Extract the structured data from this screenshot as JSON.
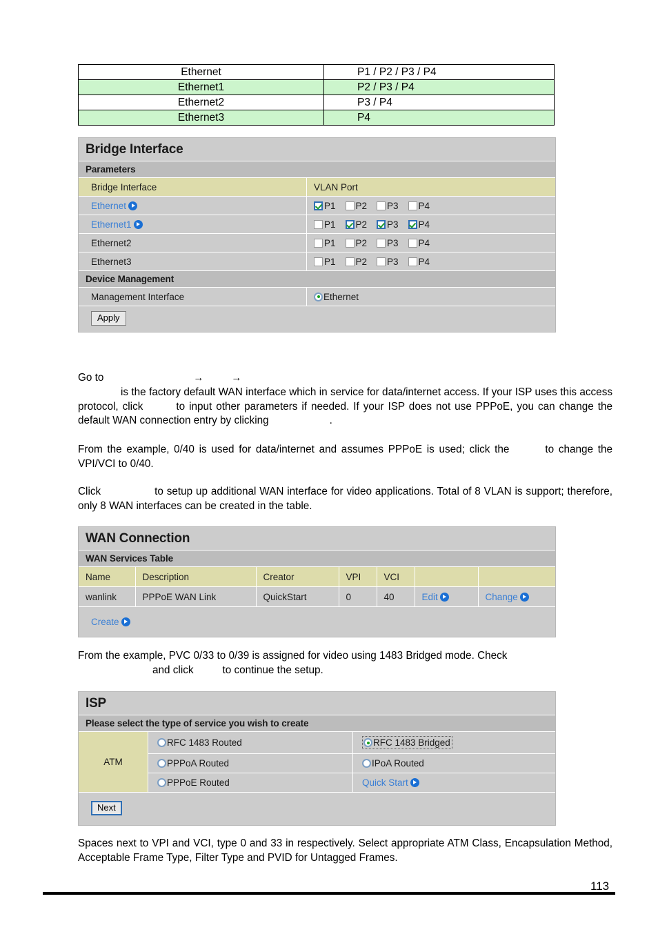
{
  "vlan_table": {
    "rows": [
      {
        "interface": "Ethernet",
        "ports": "P1 / P2 / P3 / P4"
      },
      {
        "interface": "Ethernet1",
        "ports": "P2 / P3 / P4"
      },
      {
        "interface": "Ethernet2",
        "ports": "P3 / P4"
      },
      {
        "interface": "Ethernet3",
        "ports": "P4"
      }
    ]
  },
  "bridge_panel": {
    "title": "Bridge Interface",
    "subhead": "Parameters",
    "header": {
      "left": "Bridge Interface",
      "right": "VLAN Port"
    },
    "rows": [
      {
        "name": "Ethernet",
        "is_link": true,
        "ports": [
          {
            "label": "P1",
            "checked": true
          },
          {
            "label": "P2",
            "checked": false
          },
          {
            "label": "P3",
            "checked": false
          },
          {
            "label": "P4",
            "checked": false
          }
        ]
      },
      {
        "name": "Ethernet1",
        "is_link": true,
        "ports": [
          {
            "label": "P1",
            "checked": false
          },
          {
            "label": "P2",
            "checked": true
          },
          {
            "label": "P3",
            "checked": true
          },
          {
            "label": "P4",
            "checked": true
          }
        ]
      },
      {
        "name": "Ethernet2",
        "is_link": false,
        "ports": [
          {
            "label": "P1",
            "checked": false
          },
          {
            "label": "P2",
            "checked": false
          },
          {
            "label": "P3",
            "checked": false
          },
          {
            "label": "P4",
            "checked": false
          }
        ]
      },
      {
        "name": "Ethernet3",
        "is_link": false,
        "ports": [
          {
            "label": "P1",
            "checked": false
          },
          {
            "label": "P2",
            "checked": false
          },
          {
            "label": "P3",
            "checked": false
          },
          {
            "label": "P4",
            "checked": false
          }
        ]
      }
    ],
    "device_management": {
      "subhead": "Device Management",
      "label": "Management Interface",
      "option": "Ethernet",
      "selected": true
    },
    "apply_label": "Apply"
  },
  "paragraphs": {
    "p1_a": "Go to",
    "p1_arrow1": "→",
    "p1_arrow2": "→",
    "p2_a": "is the factory default WAN interface which in service for data/internet access. If your ISP uses this access protocol, click",
    "p2_b": "to input other parameters if needed.  If your ISP does not use PPPoE, you can change the default WAN connection entry by clicking",
    "p2_c": ".",
    "p3_a": "From the example, 0/40 is used for data/internet and assumes PPPoE is used; click the",
    "p3_b": "to change the VPI/VCI to 0/40.",
    "p4_a": "Click",
    "p4_b": "to setup up additional WAN interface for video applications. Total of 8 VLAN is support; therefore, only 8 WAN interfaces can be created in the table.",
    "p5_a": "From the example, PVC 0/33 to 0/39 is assigned for video using 1483 Bridged mode.  Check",
    "p5_b": "and click",
    "p5_c": "to continue the setup.",
    "p6": "Spaces next to VPI and VCI, type 0 and 33 in respectively. Select appropriate ATM Class, Encapsulation Method, Acceptable Frame Type, Filter Type and PVID for Untagged Frames."
  },
  "wan_panel": {
    "title": "WAN Connection",
    "subhead": "WAN Services Table",
    "columns": [
      "Name",
      "Description",
      "Creator",
      "VPI",
      "VCI",
      "",
      ""
    ],
    "rows": [
      {
        "name": "wanlink",
        "description": "PPPoE WAN Link",
        "creator": "QuickStart",
        "vpi": "0",
        "vci": "40",
        "edit_label": "Edit",
        "change_label": "Change"
      }
    ],
    "create_label": "Create"
  },
  "isp_panel": {
    "title": "ISP",
    "subhead": "Please select the type of service you wish to create",
    "group_label": "ATM",
    "options": [
      {
        "label": "RFC 1483 Routed",
        "selected": false,
        "focused": false,
        "is_link": false
      },
      {
        "label": "RFC 1483 Bridged",
        "selected": true,
        "focused": true,
        "is_link": false
      },
      {
        "label": "PPPoA Routed",
        "selected": false,
        "focused": false,
        "is_link": false
      },
      {
        "label": "IPoA Routed",
        "selected": false,
        "focused": false,
        "is_link": false
      },
      {
        "label": "PPPoE Routed",
        "selected": false,
        "focused": false,
        "is_link": false
      },
      {
        "label": "Quick Start",
        "selected": false,
        "focused": false,
        "is_link": true
      }
    ],
    "next_label": "Next"
  },
  "footer": {
    "page_number": "113"
  },
  "colors": {
    "panel_bg": "#cccccc",
    "subhead_bg": "#bcbcbc",
    "header_row_bg": "#dddcab",
    "link": "#3a7fd5",
    "arrow_icon": "#1a6fd4",
    "check_green": "#1d9a2e",
    "radio_green": "#17a01b",
    "table_alt_green": "#ccf5cc"
  }
}
